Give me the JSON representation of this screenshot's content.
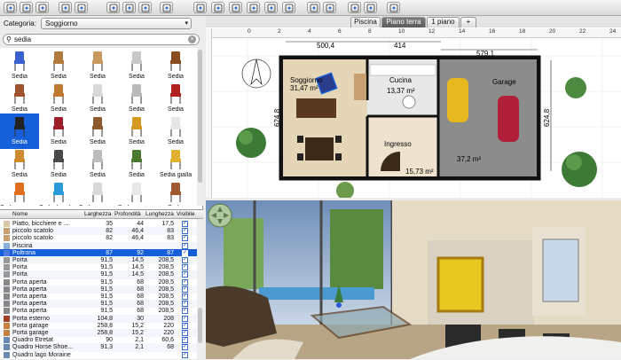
{
  "toolbar": {
    "buttons": [
      "new-icon",
      "open-icon",
      "save-icon",
      "undo-icon",
      "redo-icon",
      "cut-icon",
      "copy-icon",
      "paste-icon",
      "add-furniture-icon",
      "select-icon",
      "pan-icon",
      "create-walls-icon",
      "create-rooms-icon",
      "create-dimensions-icon",
      "add-text-icon",
      "zoom-in-icon",
      "zoom-out-icon",
      "create-photo-icon",
      "create-video-icon",
      "help-icon"
    ]
  },
  "catalog": {
    "category_label": "Categoria:",
    "category_value": "Soggiorno",
    "search_value": "sedia",
    "items": [
      {
        "label": "Sedia",
        "color": "#3a5fcf"
      },
      {
        "label": "Sedia",
        "color": "#b07a3c"
      },
      {
        "label": "Sedia",
        "color": "#c79a60"
      },
      {
        "label": "Sedia",
        "color": "#c8c8c8"
      },
      {
        "label": "Sedia",
        "color": "#8a4d20"
      },
      {
        "label": "Sedia",
        "color": "#a0522d"
      },
      {
        "label": "Sedia",
        "color": "#c0792f"
      },
      {
        "label": "Sedia",
        "color": "#d9d9d9"
      },
      {
        "label": "Sedia",
        "color": "#b9b9b9"
      },
      {
        "label": "Sedia",
        "color": "#b02020"
      },
      {
        "label": "Sedia",
        "color": "#222222",
        "selected": true
      },
      {
        "label": "Sedia",
        "color": "#9c1f2a"
      },
      {
        "label": "Sedia",
        "color": "#8c5a2b"
      },
      {
        "label": "Sedia",
        "color": "#d69a20"
      },
      {
        "label": "Sedia",
        "color": "#e6e6e6"
      },
      {
        "label": "Sedia",
        "color": "#d08a30"
      },
      {
        "label": "Sedia",
        "color": "#4a4a4a"
      },
      {
        "label": "Sedia",
        "color": "#bdbdbd"
      },
      {
        "label": "Sedia",
        "color": "#4a7a30"
      },
      {
        "label": "Sedia gialla",
        "color": "#e0b030"
      },
      {
        "label": "Sedia aranci...",
        "color": "#e07020"
      },
      {
        "label": "Sedia bambi...",
        "color": "#2a9ad8"
      },
      {
        "label": "Sedia con c...",
        "color": "#d9d9d9"
      },
      {
        "label": "Sedia con c...",
        "color": "#e8e8e8"
      },
      {
        "label": "Sedia",
        "color": "#a05a30"
      }
    ]
  },
  "furniture": {
    "headers": {
      "name": "Nome",
      "width": "Larghezza",
      "depth": "Profondità",
      "height": "Lunghezza",
      "visible": "Visibile"
    },
    "rows": [
      {
        "name": "Piatto, bicchiere e ...",
        "w": "35",
        "d": "44",
        "h": "17,5",
        "color": "#d9c7a8"
      },
      {
        "name": "piccolo scatolo",
        "w": "82",
        "d": "46,4",
        "h": "83",
        "color": "#c6a070"
      },
      {
        "name": "piccolo scatolo",
        "w": "82",
        "d": "46,4",
        "h": "83",
        "color": "#c6a070"
      },
      {
        "name": "Piscina",
        "w": "",
        "d": "",
        "h": "",
        "color": "#8ab0d8"
      },
      {
        "name": "Poltrona",
        "w": "87",
        "d": "92",
        "h": "87",
        "color": "#4a7ae0",
        "selected": true
      },
      {
        "name": "Porta",
        "w": "91,5",
        "d": "14,5",
        "h": "208,5",
        "color": "#999999"
      },
      {
        "name": "Porta",
        "w": "91,5",
        "d": "14,5",
        "h": "208,5",
        "color": "#999999"
      },
      {
        "name": "Porta",
        "w": "91,5",
        "d": "14,5",
        "h": "208,5",
        "color": "#999999"
      },
      {
        "name": "Porta aperta",
        "w": "91,5",
        "d": "68",
        "h": "208,5",
        "color": "#888888"
      },
      {
        "name": "Porta aperta",
        "w": "91,5",
        "d": "68",
        "h": "208,5",
        "color": "#888888"
      },
      {
        "name": "Porta aperta",
        "w": "91,5",
        "d": "68",
        "h": "208,5",
        "color": "#888888"
      },
      {
        "name": "Porta aperta",
        "w": "91,5",
        "d": "68",
        "h": "208,5",
        "color": "#888888"
      },
      {
        "name": "Porta aperta",
        "w": "91,5",
        "d": "68",
        "h": "208,5",
        "color": "#888888"
      },
      {
        "name": "Porta esterno",
        "w": "104,8",
        "d": "30",
        "h": "208",
        "color": "#a04020"
      },
      {
        "name": "Porta garage",
        "w": "258,8",
        "d": "15,2",
        "h": "220",
        "color": "#c88040"
      },
      {
        "name": "Porta garage",
        "w": "258,8",
        "d": "15,2",
        "h": "220",
        "color": "#c88040"
      },
      {
        "name": "Quadro Etretat",
        "w": "90",
        "d": "2,1",
        "h": "60,6",
        "color": "#6a8ab0"
      },
      {
        "name": "Quadro Horse Shoe...",
        "w": "91,3",
        "d": "2,1",
        "h": "68",
        "color": "#6a8ab0"
      },
      {
        "name": "Quadro lago Moraine",
        "w": "",
        "d": "",
        "h": "",
        "color": "#6a8ab0"
      }
    ]
  },
  "plan": {
    "tabs": [
      "Piscina",
      "Piano terra",
      "1 piano",
      "+"
    ],
    "active_tab": "Piano terra",
    "ruler_labels": [
      "0",
      "2",
      "4",
      "6",
      "8",
      "10",
      "12",
      "14",
      "16",
      "18",
      "20",
      "22",
      "24"
    ],
    "rooms": [
      {
        "name": "Soggiorno",
        "area": "31,47 m²"
      },
      {
        "name": "Cucina",
        "area": "13,37 m²"
      },
      {
        "name": "Ingresso",
        "area": "15,73 m²"
      },
      {
        "name": "Garage",
        "area": "37,2 m²"
      }
    ],
    "dimensions": [
      "500,4",
      "414",
      "579,1",
      "624,8",
      "624,8"
    ]
  },
  "colors": {
    "accent": "#1560d8",
    "selection": "#1560d8"
  }
}
